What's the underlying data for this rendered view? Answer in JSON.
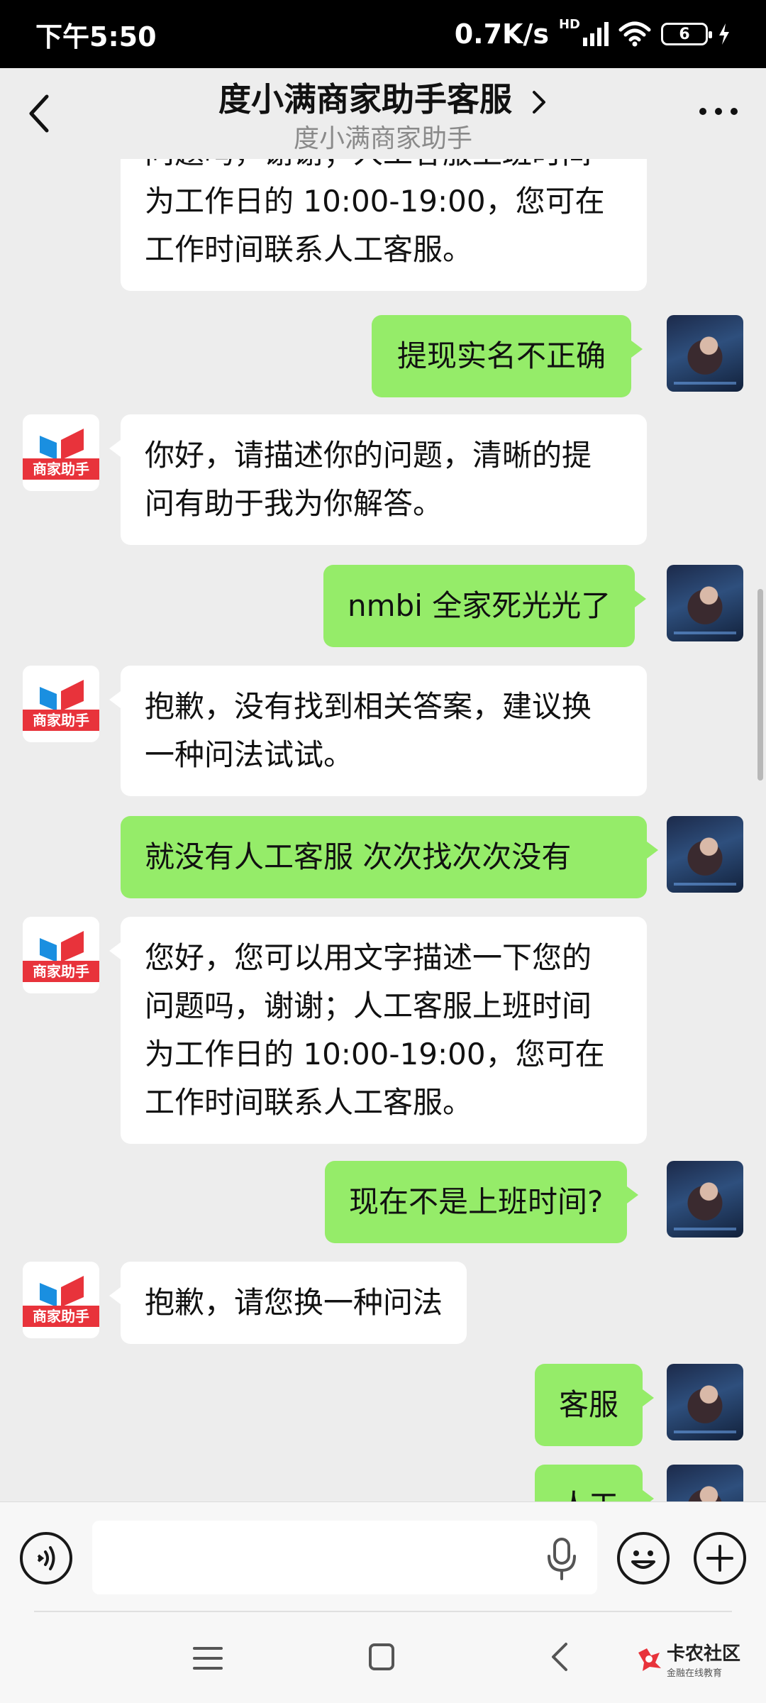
{
  "status_bar": {
    "time": "下午5:50",
    "net_speed": "0.7K/s",
    "hd_label": "HD",
    "battery_level": "6"
  },
  "header": {
    "title": "度小满商家助手客服",
    "subtitle": "度小满商家助手"
  },
  "bot_avatar_tag": "商家助手",
  "messages": [
    {
      "from": "bot",
      "lines": [
        "问题吗，谢谢；人工客服上班时间",
        "为工作日的 10:00-19:00，您可在",
        "工作时间联系人工客服。"
      ]
    },
    {
      "from": "me",
      "text": "提现实名不正确"
    },
    {
      "from": "bot",
      "lines": [
        "你好，请描述你的问题，清晰的提",
        "问有助于我为你解答。"
      ]
    },
    {
      "from": "me",
      "text": "nmbi 全家死光光了"
    },
    {
      "from": "bot",
      "lines": [
        "抱歉，没有找到相关答案，建议换",
        "一种问法试试。"
      ]
    },
    {
      "from": "me",
      "text": "就没有人工客服 次次找次次没有"
    },
    {
      "from": "bot",
      "lines": [
        "您好，您可以用文字描述一下您的",
        "问题吗，谢谢；人工客服上班时间",
        "为工作日的 10:00-19:00，您可在",
        "工作时间联系人工客服。"
      ]
    },
    {
      "from": "me",
      "text": "现在不是上班时间?"
    },
    {
      "from": "bot",
      "lines": [
        "抱歉，请您换一种问法"
      ]
    },
    {
      "from": "me",
      "text": "客服"
    },
    {
      "from": "me",
      "text": "人工"
    }
  ],
  "input": {
    "placeholder": "",
    "value": ""
  },
  "watermark": {
    "text": "卡农社区",
    "sub": "金融在线教育"
  },
  "colors": {
    "my_bubble": "#95ec69",
    "bot_bubble": "#ffffff",
    "background": "#ededed",
    "logo_red": "#e8333b",
    "logo_blue": "#1a8fe0"
  }
}
